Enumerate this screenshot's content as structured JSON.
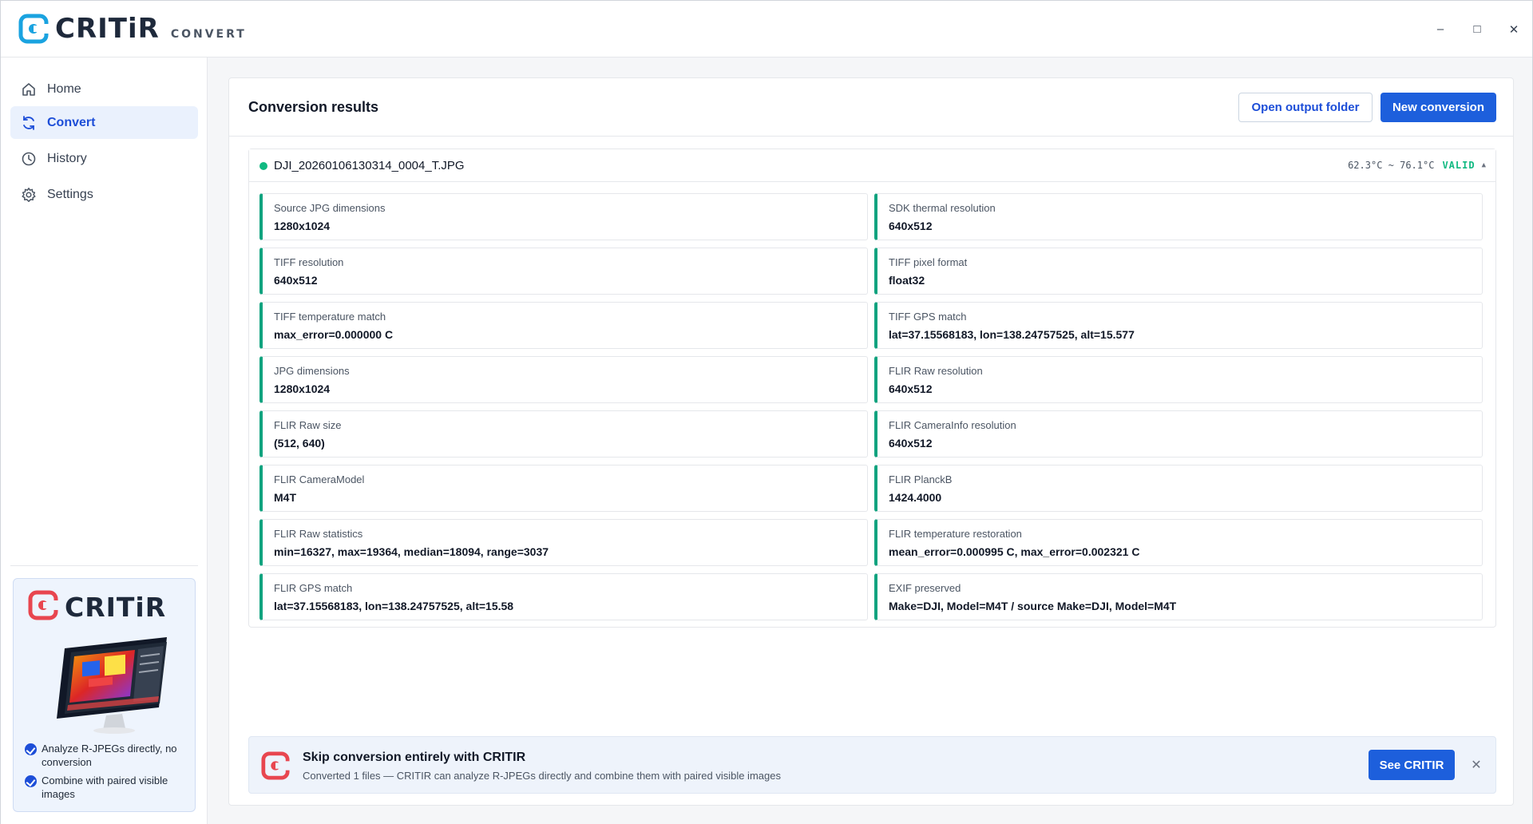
{
  "app": {
    "logo_word": "CRITiR",
    "logo_sub": "CONVERT"
  },
  "window_controls": {
    "minimize": "–",
    "maximize": "□",
    "close": "✕"
  },
  "sidebar": {
    "items": [
      {
        "label": "Home",
        "icon": "home-icon",
        "active": false
      },
      {
        "label": "Convert",
        "icon": "sync-icon",
        "active": true
      },
      {
        "label": "History",
        "icon": "clock-icon",
        "active": false
      },
      {
        "label": "Settings",
        "icon": "gear-icon",
        "active": false
      }
    ],
    "promo": {
      "logo_word": "CRITiR",
      "bullets": [
        "Analyze R-JPEGs directly, no conversion",
        "Combine with paired visible images"
      ]
    }
  },
  "main": {
    "title": "Conversion results",
    "open_folder_label": "Open output folder",
    "new_conversion_label": "New conversion",
    "file": {
      "name": "DJI_20260106130314_0004_T.JPG",
      "temp_range": "62.3°C ~ 76.1°C",
      "status": "VALID",
      "caret": "▲",
      "fields": [
        {
          "label": "Source JPG dimensions",
          "value": "1280x1024"
        },
        {
          "label": "SDK thermal resolution",
          "value": "640x512"
        },
        {
          "label": "TIFF resolution",
          "value": "640x512"
        },
        {
          "label": "TIFF pixel format",
          "value": "float32"
        },
        {
          "label": "TIFF temperature match",
          "value": "max_error=0.000000 C"
        },
        {
          "label": "TIFF GPS match",
          "value": "lat=37.15568183, lon=138.24757525, alt=15.577"
        },
        {
          "label": "JPG dimensions",
          "value": "1280x1024"
        },
        {
          "label": "FLIR Raw resolution",
          "value": "640x512"
        },
        {
          "label": "FLIR Raw size",
          "value": "(512, 640)"
        },
        {
          "label": "FLIR CameraInfo resolution",
          "value": "640x512"
        },
        {
          "label": "FLIR CameraModel",
          "value": "M4T"
        },
        {
          "label": "FLIR PlanckB",
          "value": "1424.4000"
        },
        {
          "label": "FLIR Raw statistics",
          "value": "min=16327, max=19364, median=18094, range=3037"
        },
        {
          "label": "FLIR temperature restoration",
          "value": "mean_error=0.000995 C, max_error=0.002321 C"
        },
        {
          "label": "FLIR GPS match",
          "value": "lat=37.15568183, lon=138.24757525, alt=15.58"
        },
        {
          "label": "EXIF preserved",
          "value": "Make=DJI, Model=M4T / source Make=DJI, Model=M4T"
        }
      ]
    },
    "banner": {
      "title": "Skip conversion entirely with CRITIR",
      "subtitle": "Converted 1 files — CRITIR can analyze R-JPEGs directly and combine them with paired visible images",
      "button_label": "See CRITIR",
      "close": "✕"
    }
  },
  "colors": {
    "accent": "#1d5fdc",
    "valid": "#10b981",
    "logo_blue": "#1aa3e0",
    "logo_red": "#e8464f"
  }
}
